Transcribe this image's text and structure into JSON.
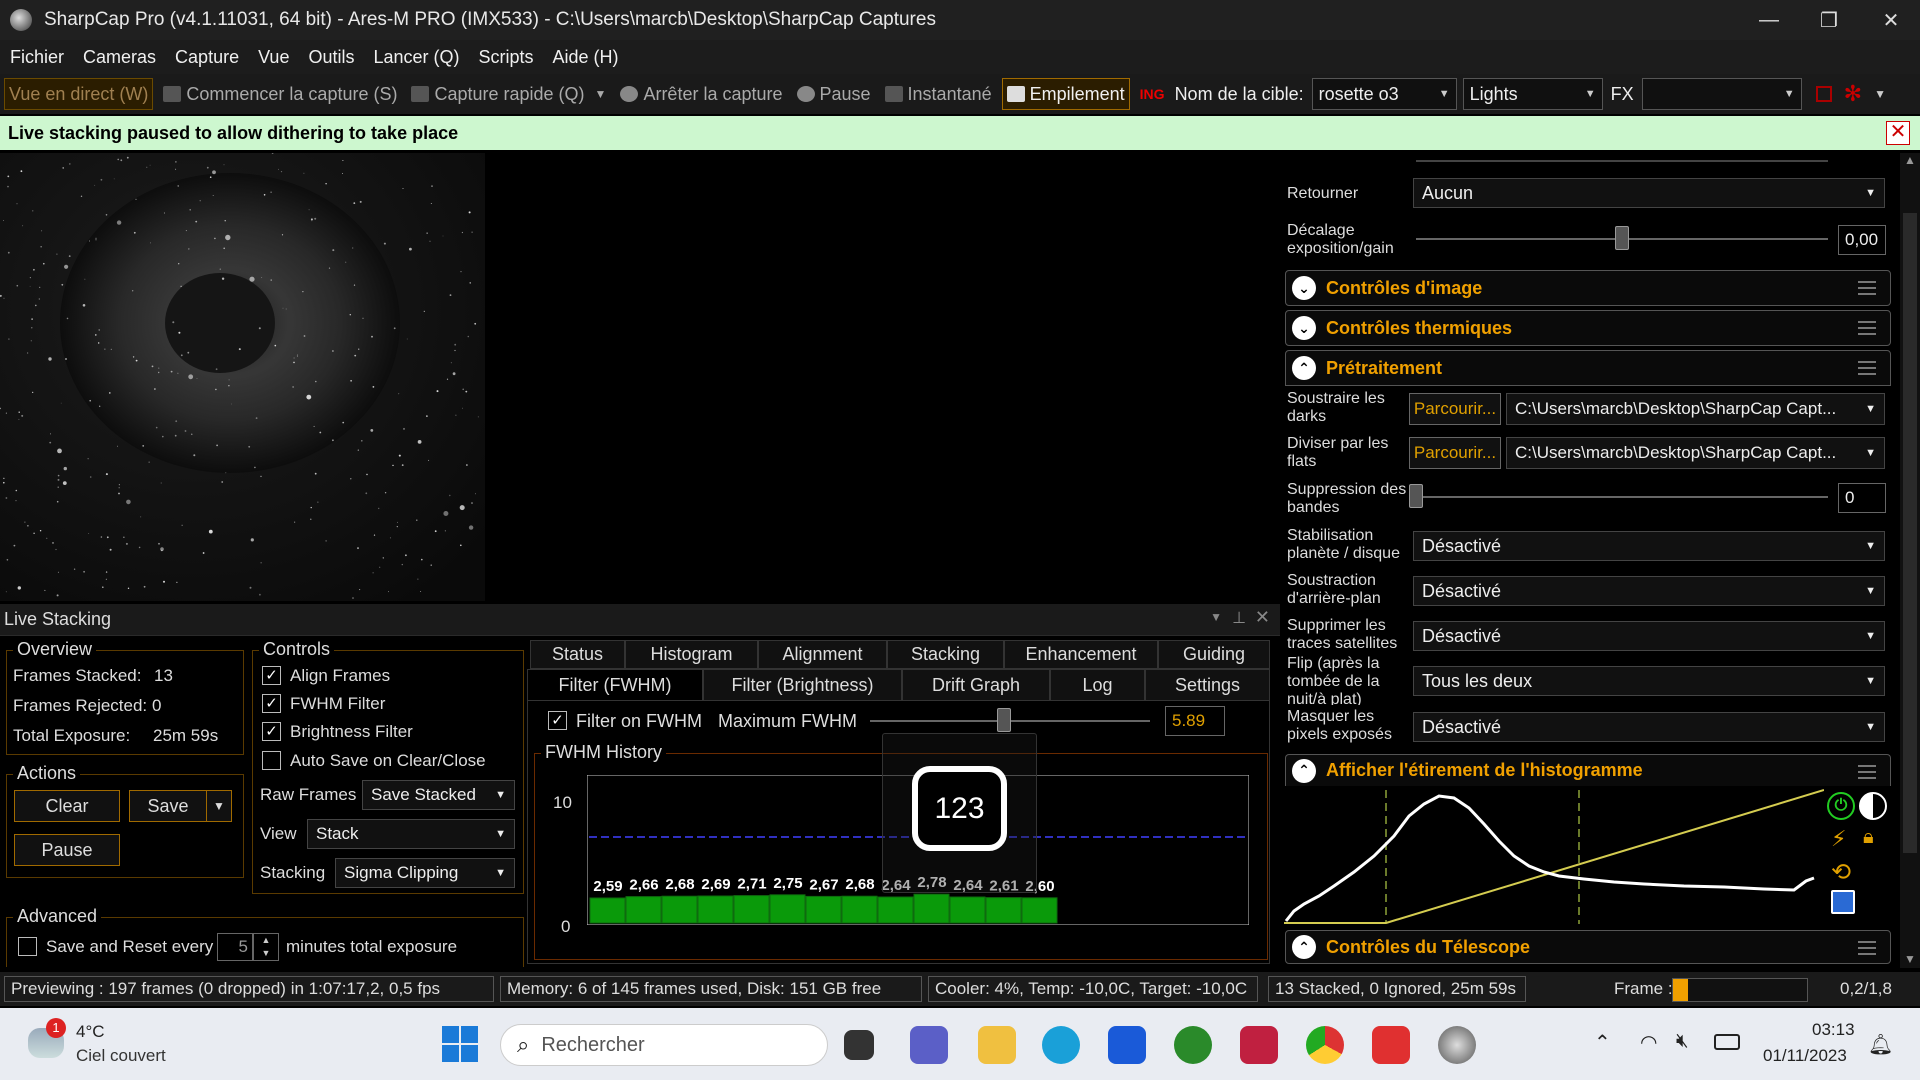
{
  "window": {
    "title": "SharpCap Pro (v4.1.11031, 64 bit) - Ares-M PRO (IMX533) - C:\\Users\\marcb\\Desktop\\SharpCap Captures",
    "minimize": "—",
    "maximize": "❐",
    "close": "✕"
  },
  "menu": [
    "Fichier",
    "Cameras",
    "Capture",
    "Vue",
    "Outils",
    "Lancer (Q)",
    "Scripts",
    "Aide (H)"
  ],
  "toolbar": {
    "live_view": "Vue en direct (W)",
    "start_capture": "Commencer la capture (S)",
    "quick_capture": "Capture rapide (Q)",
    "stop_capture": "Arrêter la capture",
    "pause": "Pause",
    "snapshot": "Instantané",
    "stacking": "Empilement",
    "target_label": "Nom de la cible:",
    "target_value": "rosette o3",
    "frame_type": "Lights",
    "fx_label": "FX",
    "fx_value": ""
  },
  "notification": "Live stacking paused to allow dithering to take place",
  "live_stacking": {
    "title": "Live Stacking",
    "overview": {
      "legend": "Overview",
      "frames_stacked_label": "Frames Stacked:",
      "frames_stacked": "13",
      "frames_rejected_label": "Frames Rejected:",
      "frames_rejected": "0",
      "total_exposure_label": "Total Exposure:",
      "total_exposure": "25m 59s"
    },
    "actions": {
      "legend": "Actions",
      "clear": "Clear",
      "save": "Save",
      "pause": "Pause"
    },
    "advanced": {
      "legend": "Advanced",
      "save_reset_label": "Save and Reset every",
      "minutes": "5",
      "minutes_suffix": "minutes total exposure"
    },
    "controls": {
      "legend": "Controls",
      "align_frames": "Align Frames",
      "fwhm_filter": "FWHM Filter",
      "brightness_filter": "Brightness Filter",
      "auto_save": "Auto Save on Clear/Close",
      "raw_frames_label": "Raw Frames",
      "raw_frames_value": "Save Stacked",
      "view_label": "View",
      "view_value": "Stack",
      "stacking_label": "Stacking",
      "stacking_value": "Sigma Clipping"
    },
    "tabs_row1": [
      "Status",
      "Histogram",
      "Alignment",
      "Stacking",
      "Enhancement",
      "Guiding"
    ],
    "tabs_row2": [
      "Filter (FWHM)",
      "Filter (Brightness)",
      "Drift Graph",
      "Log",
      "Settings"
    ],
    "filter": {
      "label": "Filter on FWHM",
      "max_label": "Maximum FWHM",
      "max_value": "5.89",
      "max_level": 0.48
    },
    "history": {
      "legend": "FWHM History",
      "y_max": "10",
      "y_min": "0",
      "overlay_value": "123"
    }
  },
  "chart_data": {
    "type": "bar",
    "title": "FWHM History",
    "values": [
      2.59,
      2.66,
      2.68,
      2.69,
      2.71,
      2.75,
      2.67,
      2.68,
      2.64,
      2.78,
      2.64,
      2.61,
      2.6
    ],
    "labels": [
      "2,59",
      "2,66",
      "2,68",
      "2,69",
      "2,71",
      "2,75",
      "2,67",
      "2,68",
      "2,64",
      "2,78",
      "2,64",
      "2,61",
      "2,60"
    ],
    "ylim": [
      0,
      10
    ],
    "threshold": 5.89,
    "bar_color": "#0a9a0a",
    "threshold_color": "#3030c0"
  },
  "right_panel": {
    "flip_label": "Retourner",
    "flip_value": "Aucun",
    "offset_label": "Décalage exposition/gain",
    "offset_value": "0,00",
    "offset_level": 0.5,
    "sections": {
      "image_controls": "Contrôles d'image",
      "thermal_controls": "Contrôles thermiques",
      "preprocessing": "Prétraitement",
      "histogram_stretch": "Afficher l'étirement de l'histogramme",
      "telescope_controls": "Contrôles du Télescope"
    },
    "darks_label": "Soustraire les darks",
    "darks_btn": "Parcourir...",
    "darks_path": "C:\\Users\\marcb\\Desktop\\SharpCap Capt...",
    "flats_label": "Diviser par les flats",
    "flats_btn": "Parcourir...",
    "flats_path": "C:\\Users\\marcb\\Desktop\\SharpCap Capt...",
    "banding_label": "Suppression des bandes",
    "banding_value": "0",
    "planet_label": "Stabilisation planète / disque",
    "planet_value": "Désactivé",
    "background_label": "Soustraction d'arrière-plan",
    "background_value": "Désactivé",
    "satellite_label": "Supprimer les traces satellites",
    "satellite_value": "Désactivé",
    "flip_after_label": "Flip (après la tombée de la nuit/à plat)",
    "flip_after_value": "Tous les deux",
    "hot_pixels_label": "Masquer les pixels exposés",
    "hot_pixels_value": "Désactivé"
  },
  "status": {
    "previewing": "Previewing : 197 frames (0 dropped) in 1:07:17,2, 0,5 fps",
    "memory": "Memory: 6 of 145 frames used, Disk: 151 GB free",
    "cooler": "Cooler: 4%, Temp: -10,0C, Target: -10,0C",
    "stacked": "13 Stacked, 0 Ignored, 25m 59s",
    "frame_label": "Frame :",
    "frame_value": "0,2/1,8",
    "frame_progress": 0.11
  },
  "taskbar": {
    "weather_badge": "1",
    "temperature": "4°C",
    "weather": "Ciel couvert",
    "search": "Rechercher",
    "time": "03:13",
    "date": "01/11/2023"
  }
}
